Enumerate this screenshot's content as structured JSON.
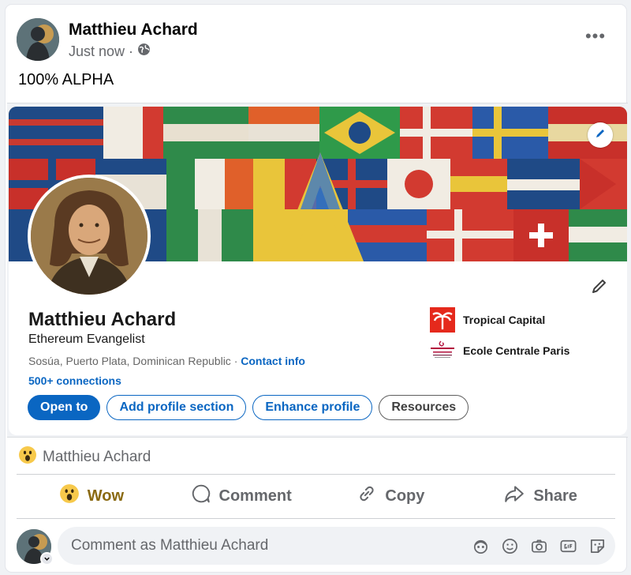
{
  "post": {
    "author": "Matthieu Achard",
    "timestamp": "Just now",
    "separator": "·",
    "privacy_icon": "globe-icon",
    "more_icon": "more-dots-icon",
    "more_label": "•••",
    "text": "100% ALPHA"
  },
  "profile_card": {
    "name": "Matthieu Achard",
    "headline": "Ethereum Evangelist",
    "location": "Sosúa, Puerto Plata, Dominican Republic",
    "location_sep": " · ",
    "contact_info": "Contact info",
    "connections": "500+ connections",
    "experience": [
      {
        "name": "Tropical Capital",
        "logo_icon": "palm-tree-icon",
        "logo_color": "#e5291c"
      },
      {
        "name": "Ecole Centrale Paris",
        "logo_icon": "centrale-supelec-logo",
        "logo_color": "#b3123e"
      }
    ],
    "buttons": {
      "open_to": "Open to",
      "add_section": "Add profile section",
      "enhance": "Enhance profile",
      "resources": "Resources"
    }
  },
  "reactions": {
    "emoji_icon": "wow-emoji-icon",
    "who": "Matthieu Achard"
  },
  "actions": {
    "wow": "Wow",
    "comment": "Comment",
    "copy": "Copy",
    "share": "Share"
  },
  "comment_box": {
    "placeholder": "Comment as Matthieu Achard",
    "icons": [
      "avatar-sticker-icon",
      "emoji-icon",
      "camera-icon",
      "gif-icon",
      "sticker-icon"
    ]
  },
  "colors": {
    "linkedin_blue": "#0a66c2",
    "facebook_gray": "#65676b",
    "wow_text": "#8a6a12"
  }
}
